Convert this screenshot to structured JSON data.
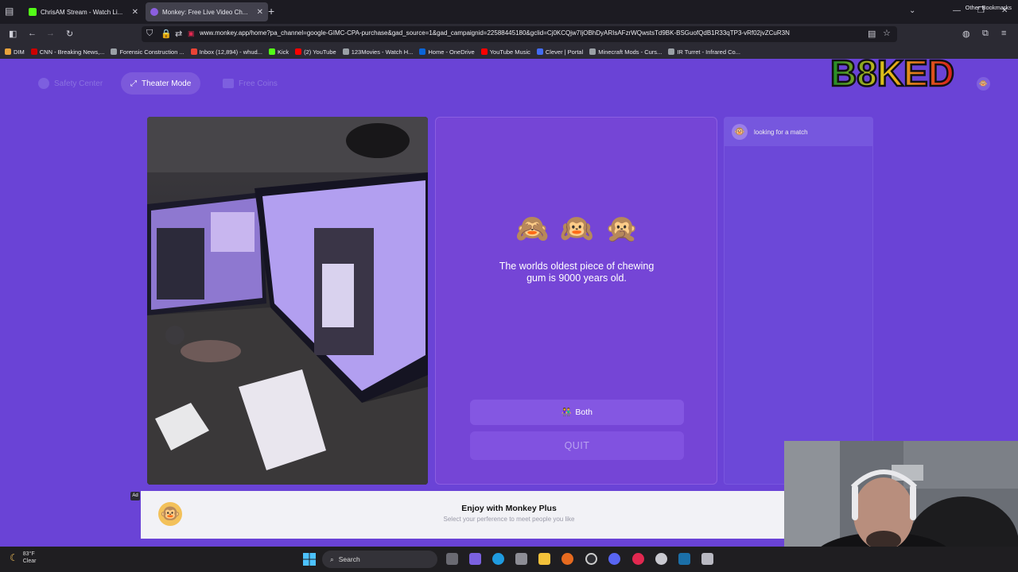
{
  "browser": {
    "tabs": [
      {
        "title": "ChrisAM Stream - Watch Li...",
        "favicon_color": "#53fc18",
        "icon": "kick-icon"
      },
      {
        "title": "Monkey: Free Live Video Ch...",
        "favicon_color": "#8b5ee0",
        "icon": "speaker-icon"
      }
    ],
    "url": "www.monkey.app/home?pa_channel=google-GIMC-CPA-purchase&gad_source=1&gad_campaignid=22588445180&gclid=Cj0KCQjw7IjOBhDyARIsAFzrWQwstsTd9BK-BSGuofQdB1R33qTP3-vRf02jvZCuR3N",
    "bookmarks": [
      {
        "label": "DIM",
        "color": "#e8a33d"
      },
      {
        "label": "CNN - Breaking News,...",
        "color": "#cc0000"
      },
      {
        "label": "Forensic Construction ...",
        "color": "#9aa0a6"
      },
      {
        "label": "Inbox (12,894) - whud...",
        "color": "#ea4335"
      },
      {
        "label": "Kick",
        "color": "#53fc18"
      },
      {
        "label": "(2) YouTube",
        "color": "#ff0000"
      },
      {
        "label": "123Movies - Watch H...",
        "color": "#9aa0a6"
      },
      {
        "label": "Home - OneDrive",
        "color": "#0a64d8"
      },
      {
        "label": "YouTube Music",
        "color": "#ff0000"
      },
      {
        "label": "Clever | Portal",
        "color": "#436cf2"
      },
      {
        "label": "Minecraft Mods - Curs...",
        "color": "#9aa0a6"
      },
      {
        "label": "IR Turret - Infrared Co...",
        "color": "#9aa0a6"
      }
    ],
    "other_bookmarks": "Other Bookmarks"
  },
  "site": {
    "nav": {
      "safety": "Safety Center",
      "theater": "Theater Mode",
      "coins": "Free Coins"
    },
    "match": {
      "emojis": [
        "🙈",
        "🙉",
        "🙊"
      ],
      "fact": "The worlds oldest piece of chewing gum is 9000 years old.",
      "both_label": "Both",
      "quit_label": "QUIT"
    },
    "chat": {
      "status": "looking for a match"
    },
    "ad": {
      "label": "Ad",
      "title": "Enjoy with Monkey Plus",
      "subtitle": "Select your perference to meet people you like"
    }
  },
  "overlay": {
    "logo_text": "B8KED"
  },
  "taskbar": {
    "temp": "83°F",
    "condition": "Clear",
    "search_label": "Search"
  },
  "colors": {
    "page_bg": "#6a43d6",
    "panel": "#7545d6",
    "accent": "#8457e2"
  }
}
